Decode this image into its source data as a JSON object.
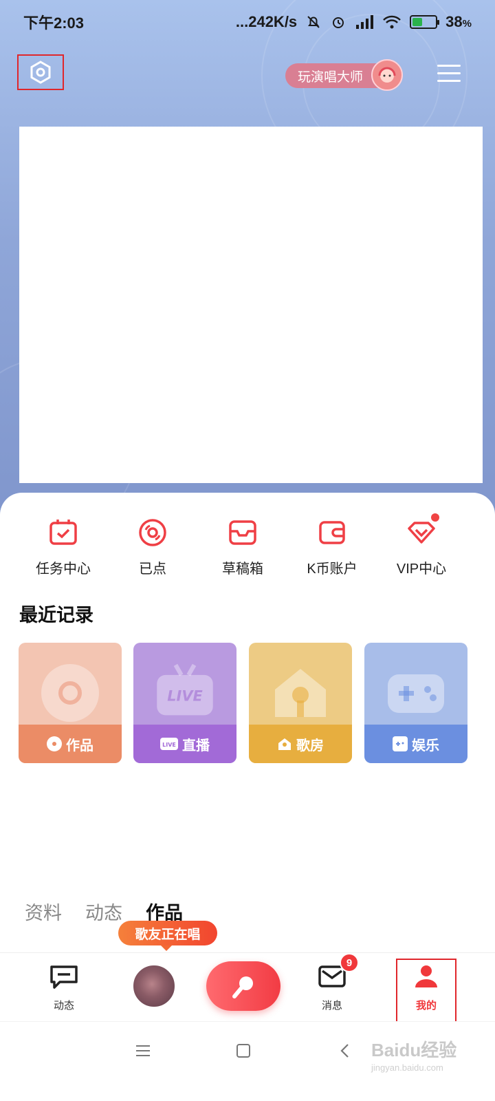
{
  "status_bar": {
    "time": "下午2:03",
    "network_speed": "...242K/s",
    "battery": "38",
    "battery_unit": "%"
  },
  "header": {
    "master_label": "玩演唱大师"
  },
  "quick_actions": [
    {
      "label": "任务中心",
      "icon": "calendar-check-icon"
    },
    {
      "label": "已点",
      "icon": "disc-icon"
    },
    {
      "label": "草稿箱",
      "icon": "inbox-icon"
    },
    {
      "label": "K币账户",
      "icon": "wallet-icon"
    },
    {
      "label": "VIP中心",
      "icon": "vip-diamond-icon"
    }
  ],
  "recent": {
    "title": "最近记录",
    "cards": [
      {
        "label": "作品",
        "color": "#eb8c66"
      },
      {
        "label": "直播",
        "color": "#a26ad7"
      },
      {
        "label": "歌房",
        "color": "#e7ae3f"
      },
      {
        "label": "娱乐",
        "color": "#6b8fe0"
      }
    ]
  },
  "profile_tabs": [
    "资料",
    "动态",
    "作品"
  ],
  "bubble": "歌友正在唱",
  "bottom_nav": {
    "feed": "动态",
    "messages": "消息",
    "messages_badge": "9",
    "mine": "我的"
  },
  "watermark": {
    "brand": "Baidu经验",
    "url": "jingyan.baidu.com"
  },
  "colors": {
    "accent": "#f0383b",
    "highlight_box": "#e0262b"
  }
}
